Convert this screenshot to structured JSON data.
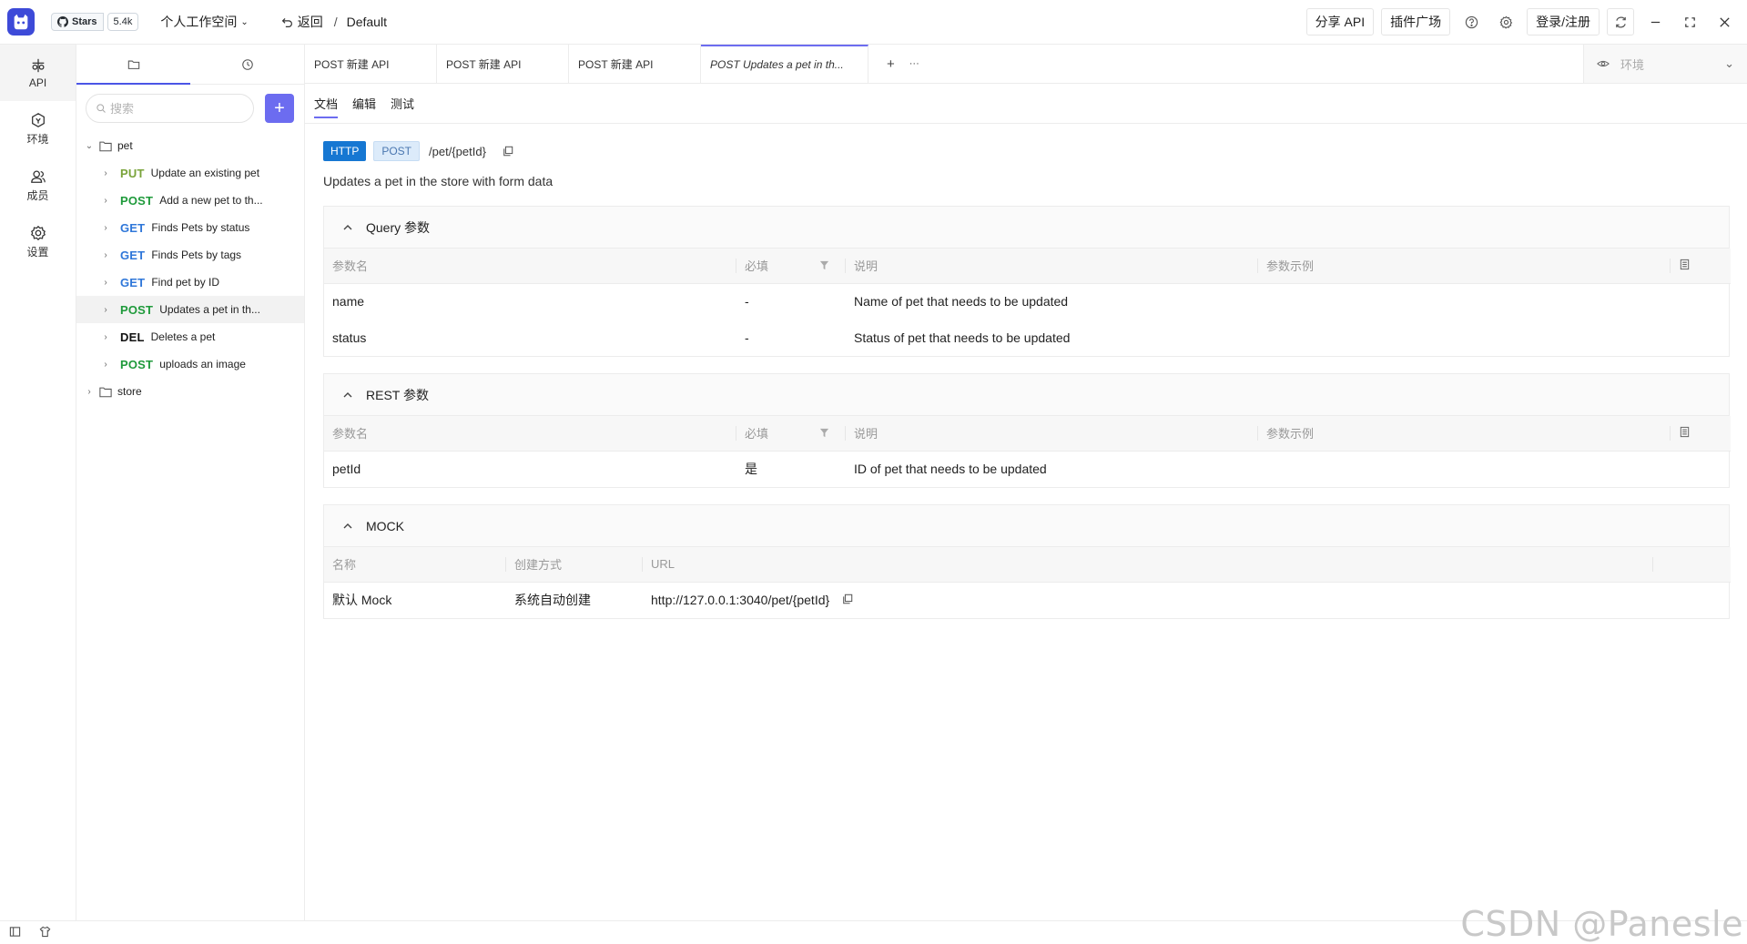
{
  "topbar": {
    "github_stars_label": "Stars",
    "github_stars_count": "5.4k",
    "workspace_label": "个人工作空间",
    "back_label": "返回",
    "breadcrumb_sep": "/",
    "breadcrumb_current": "Default",
    "share_api_label": "分享 API",
    "plugin_market_label": "插件广场",
    "login_label": "登录/注册"
  },
  "leftnav": {
    "items": [
      {
        "label": "API",
        "icon": "api-icon",
        "active": true
      },
      {
        "label": "环境",
        "icon": "environment-icon",
        "active": false
      },
      {
        "label": "成员",
        "icon": "members-icon",
        "active": false
      },
      {
        "label": "设置",
        "icon": "settings-icon",
        "active": false
      }
    ]
  },
  "tree": {
    "search_placeholder": "搜索",
    "add_label": "+",
    "folders": [
      {
        "name": "pet",
        "expanded": true
      },
      {
        "name": "store",
        "expanded": false
      }
    ],
    "pet_items": [
      {
        "method": "PUT",
        "label": "Update an existing pet"
      },
      {
        "method": "POST",
        "label": "Add a new pet to th..."
      },
      {
        "method": "GET",
        "label": "Finds Pets by status"
      },
      {
        "method": "GET",
        "label": "Finds Pets by tags"
      },
      {
        "method": "GET",
        "label": "Find pet by ID"
      },
      {
        "method": "POST",
        "label": "Updates a pet in th...",
        "selected": true
      },
      {
        "method": "DEL",
        "label": "Deletes a pet"
      },
      {
        "method": "POST",
        "label": "uploads an image"
      }
    ]
  },
  "tabs": [
    {
      "label": "POST 新建 API"
    },
    {
      "label": "POST 新建 API"
    },
    {
      "label": "POST 新建 API"
    },
    {
      "label": "POST Updates a pet in th...",
      "active": true
    }
  ],
  "tab_actions": {
    "add": "+",
    "more": "···"
  },
  "env": {
    "placeholder": "环境"
  },
  "subtabs": {
    "doc": "文档",
    "edit": "编辑",
    "test": "测试"
  },
  "api": {
    "protocol": "HTTP",
    "method": "POST",
    "path": "/pet/{petId}",
    "summary": "Updates a pet in the store with form data"
  },
  "query_section": {
    "title": "Query 参数",
    "headers": {
      "name": "参数名",
      "required": "必填",
      "desc": "说明",
      "example": "参数示例"
    },
    "rows": [
      {
        "name": "name",
        "required": "-",
        "desc": "Name of pet that needs to be updated",
        "example": ""
      },
      {
        "name": "status",
        "required": "-",
        "desc": "Status of pet that needs to be updated",
        "example": ""
      }
    ]
  },
  "rest_section": {
    "title": "REST 参数",
    "headers": {
      "name": "参数名",
      "required": "必填",
      "desc": "说明",
      "example": "参数示例"
    },
    "rows": [
      {
        "name": "petId",
        "required": "是",
        "desc": "ID of pet that needs to be updated",
        "example": ""
      }
    ]
  },
  "mock_section": {
    "title": "MOCK",
    "headers": {
      "name": "名称",
      "created_by": "创建方式",
      "url": "URL"
    },
    "rows": [
      {
        "name": "默认 Mock",
        "created_by": "系统自动创建",
        "url": "http://127.0.0.1:3040/pet/{petId}"
      }
    ]
  },
  "watermark": "CSDN @Panesle",
  "colors": {
    "accent": "#6c6cf0",
    "http_tag": "#1677d2",
    "method_put": "#79a33a",
    "method_post": "#1f9a3b",
    "method_get": "#2f77d9",
    "method_del": "#111111"
  }
}
